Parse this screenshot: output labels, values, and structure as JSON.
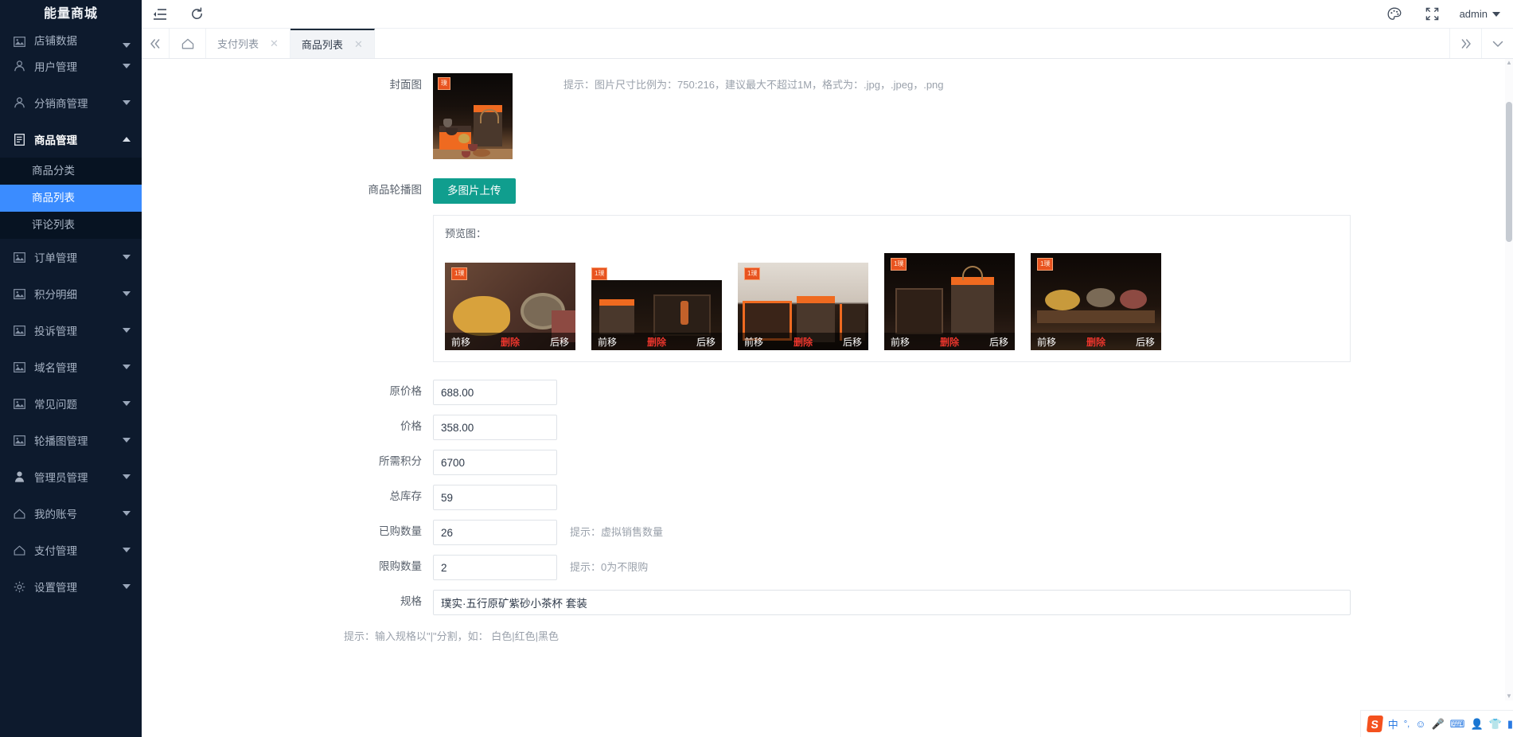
{
  "sidebar": {
    "brand": "能量商城",
    "clipped_item": {
      "label": "店铺数据",
      "icon": "image-icon"
    },
    "items": [
      {
        "label": "用户管理",
        "icon": "user-group-icon",
        "arrow": "down"
      },
      {
        "label": "分销商管理",
        "icon": "user-group-icon",
        "arrow": "down"
      },
      {
        "label": "商品管理",
        "icon": "document-icon",
        "arrow": "up",
        "expanded": true,
        "children": [
          {
            "label": "商品分类",
            "selected": false
          },
          {
            "label": "商品列表",
            "selected": true
          },
          {
            "label": "评论列表",
            "selected": false
          }
        ]
      },
      {
        "label": "订单管理",
        "icon": "image-icon",
        "arrow": "down"
      },
      {
        "label": "积分明细",
        "icon": "image-icon",
        "arrow": "down"
      },
      {
        "label": "投诉管理",
        "icon": "image-icon",
        "arrow": "down"
      },
      {
        "label": "域名管理",
        "icon": "image-icon",
        "arrow": "down"
      },
      {
        "label": "常见问题",
        "icon": "image-icon",
        "arrow": "down"
      },
      {
        "label": "轮播图管理",
        "icon": "image-icon",
        "arrow": "down"
      },
      {
        "label": "管理员管理",
        "icon": "person-icon",
        "arrow": "down"
      },
      {
        "label": "我的账号",
        "icon": "home-icon",
        "arrow": "down"
      },
      {
        "label": "支付管理",
        "icon": "home-icon",
        "arrow": "down"
      },
      {
        "label": "设置管理",
        "icon": "gear-icon",
        "arrow": "down"
      }
    ]
  },
  "topbar": {
    "collapse_icon": "menu-collapse-icon",
    "refresh_icon": "refresh-icon",
    "theme_icon": "palette-icon",
    "fullscreen_icon": "fullscreen-icon",
    "user": "admin"
  },
  "tabs": {
    "prev_icon": "double-chevron-left-icon",
    "home_icon": "home-icon",
    "items": [
      {
        "label": "支付列表",
        "active": false,
        "closable": true
      },
      {
        "label": "商品列表",
        "active": true,
        "closable": true
      }
    ],
    "next_icon": "double-chevron-right-icon",
    "dropdown_icon": "chevron-down-icon"
  },
  "form": {
    "cover": {
      "label": "封面图",
      "badge": "璞",
      "tip": "提示：图片尺寸比例为：750:216，建议最大不超过1M，格式为：.jpg，.jpeg，.png"
    },
    "carousel": {
      "label": "商品轮播图",
      "upload_button": "多图片上传",
      "preview_title": "预览图：",
      "actions": {
        "forward": "前移",
        "delete": "删除",
        "backward": "后移"
      },
      "thumbs": [
        {
          "badge": "1璞",
          "theme": "a"
        },
        {
          "badge": "1璞",
          "theme": "b"
        },
        {
          "badge": "1璞",
          "theme": "c"
        },
        {
          "badge": "1璞",
          "theme": "d"
        },
        {
          "badge": "1璞",
          "theme": "e"
        }
      ]
    },
    "fields": [
      {
        "label": "原价格",
        "value": "688.00",
        "tip": ""
      },
      {
        "label": "价格",
        "value": "358.00",
        "tip": ""
      },
      {
        "label": "所需积分",
        "value": "6700",
        "tip": ""
      },
      {
        "label": "总库存",
        "value": "59",
        "tip": ""
      },
      {
        "label": "已购数量",
        "value": "26",
        "tip": "提示：虚拟销售数量"
      },
      {
        "label": "限购数量",
        "value": "2",
        "tip": "提示：0为不限购"
      }
    ],
    "spec": {
      "label": "规格",
      "value": "璞实·五行原矿紫砂小茶杯 套装",
      "tip": "提示：输入规格以\"|\"分割，如： 白色|红色|黑色"
    }
  },
  "ime": {
    "logo": "S",
    "items": [
      "中",
      "°,",
      "☺",
      "🎤",
      "⌨",
      "👤",
      "👕",
      "▮"
    ]
  },
  "colors": {
    "sidebar_bg": "#0d1a2d",
    "submenu_bg": "#071322",
    "active_blue": "#3b8cff",
    "upload_green": "#109e8e",
    "delete_red": "#e8352c",
    "badge_orange": "#e8531f"
  }
}
